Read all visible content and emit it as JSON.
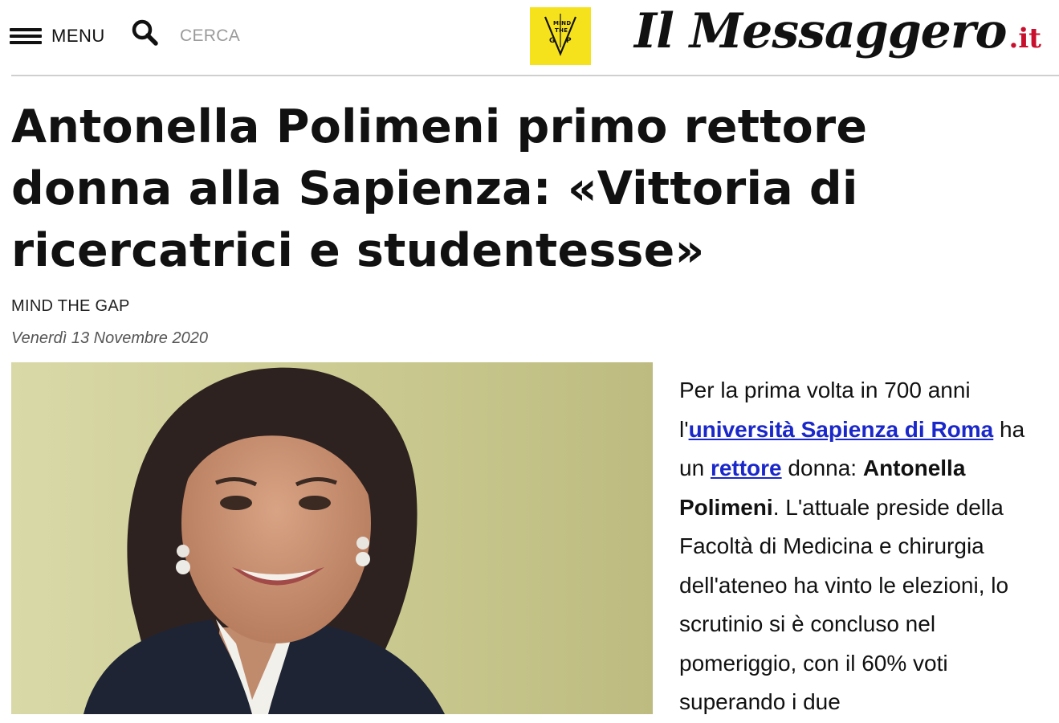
{
  "header": {
    "menu_label": "MENU",
    "search_label": "CERCA",
    "partner_logo_text": [
      "MIND",
      "THE",
      "G",
      "P"
    ],
    "masthead_name": "Il Messaggero",
    "masthead_tld": ".it"
  },
  "article": {
    "headline_lines": [
      "Antonella Polimeni primo rettore",
      "donna alla Sapienza: «Vittoria di",
      "ricercatrici e studentesse»"
    ],
    "section": "MIND THE GAP",
    "date": "Venerdì 13 Novembre 2020",
    "body": {
      "t1": "Per la prima volta in 700 anni l'",
      "link1": "università Sapienza di Roma",
      "t2": " ha un ",
      "link2": "rettore",
      "t3": " donna: ",
      "bold1": "Antonella Polimeni",
      "t4": ". L'attuale preside della Facoltà di Medicina e chirurgia dell'ateneo ha vinto le elezioni, lo scrutinio si è concluso nel pomeriggio, con il 60% voti superando i due"
    }
  },
  "colors": {
    "link": "#1a27c9",
    "masthead_accent": "#c8102e",
    "partner_logo_bg": "#f6e21c"
  },
  "icons": [
    "menu-icon",
    "search-icon"
  ]
}
